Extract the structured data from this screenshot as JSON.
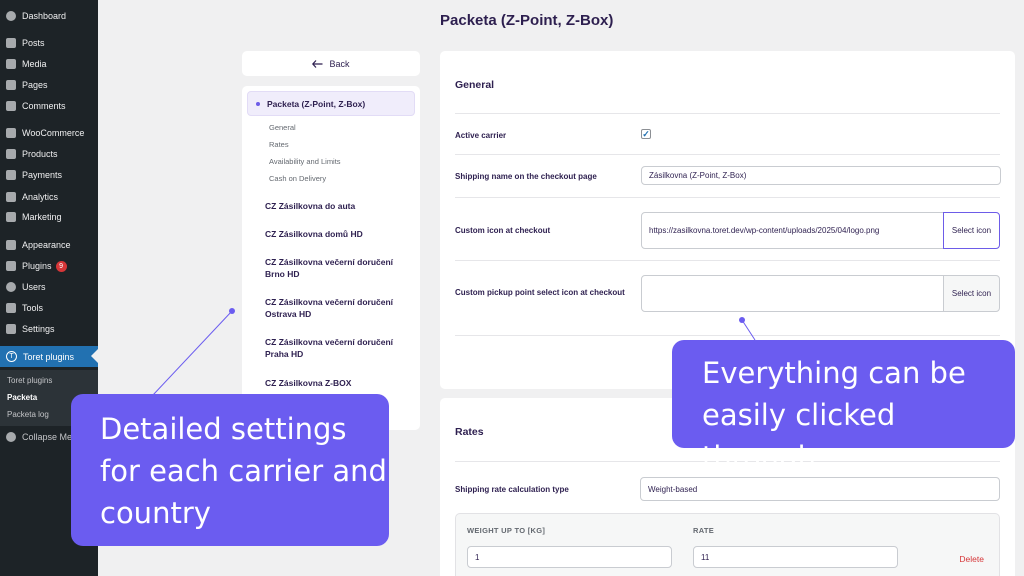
{
  "wp_menu": {
    "items": [
      {
        "label": "Dashboard",
        "icon": "dashboard-icon"
      },
      {
        "label": "Posts",
        "icon": "pin-icon"
      },
      {
        "label": "Media",
        "icon": "media-icon"
      },
      {
        "label": "Pages",
        "icon": "pages-icon"
      },
      {
        "label": "Comments",
        "icon": "comments-icon"
      },
      {
        "label": "WooCommerce",
        "icon": "woocommerce-icon"
      },
      {
        "label": "Products",
        "icon": "products-icon"
      },
      {
        "label": "Payments",
        "icon": "payments-icon"
      },
      {
        "label": "Analytics",
        "icon": "analytics-icon"
      },
      {
        "label": "Marketing",
        "icon": "marketing-icon"
      },
      {
        "label": "Appearance",
        "icon": "appearance-icon"
      },
      {
        "label": "Plugins",
        "icon": "plugins-icon",
        "badge": "9"
      },
      {
        "label": "Users",
        "icon": "users-icon"
      },
      {
        "label": "Tools",
        "icon": "tools-icon"
      },
      {
        "label": "Settings",
        "icon": "settings-icon"
      },
      {
        "label": "Toret plugins",
        "icon": "toret-icon",
        "icon_letter": "T"
      }
    ],
    "submenu": [
      "Toret plugins",
      "Packeta",
      "Packeta log"
    ],
    "collapse_label": "Collapse Menu"
  },
  "page": {
    "title": "Packeta (Z-Point, Z-Box)",
    "back_label": "Back"
  },
  "carrier_nav": {
    "active_label": "Packeta (Z-Point, Z-Box)",
    "subsections": [
      "General",
      "Rates",
      "Availability and Limits",
      "Cash on Delivery"
    ],
    "carriers": [
      "CZ Zásilkovna do auta",
      "CZ Zásilkovna domů HD",
      "CZ Zásilkovna večerní doručení Brno HD",
      "CZ Zásilkovna večerní doručení Ostrava HD",
      "CZ Zásilkovna večerní doručení Praha HD",
      "CZ Zásilkovna Z-BOX"
    ]
  },
  "general": {
    "title": "General",
    "active_carrier_label": "Active carrier",
    "active_carrier_checked": true,
    "shipping_name_label": "Shipping name on the checkout page",
    "shipping_name_value": "Zásilkovna (Z-Point, Z-Box)",
    "custom_icon_label": "Custom icon at checkout",
    "custom_icon_value": "https://zasilkovna.toret.dev/wp-content/uploads/2025/04/logo.png",
    "pickup_icon_label": "Custom pickup point select icon at checkout",
    "pickup_icon_value": "",
    "select_icon_label": "Select icon"
  },
  "rates": {
    "title": "Rates",
    "calc_type_label": "Shipping rate calculation type",
    "calc_type_value": "Weight-based",
    "col_weight": "WEIGHT UP TO [KG]",
    "col_rate": "RATE",
    "rows": [
      {
        "weight": "1",
        "rate": "11",
        "delete_label": "Delete"
      }
    ]
  },
  "callouts": {
    "left": "Detailed settings for each carrier and country",
    "right": "Everything can be easily clicked through"
  },
  "colors": {
    "accent": "#6b5cf0",
    "wp_sidebar": "#1d2327",
    "wp_active": "#2271b1",
    "heading": "#2d1f4f",
    "danger": "#d63638"
  }
}
